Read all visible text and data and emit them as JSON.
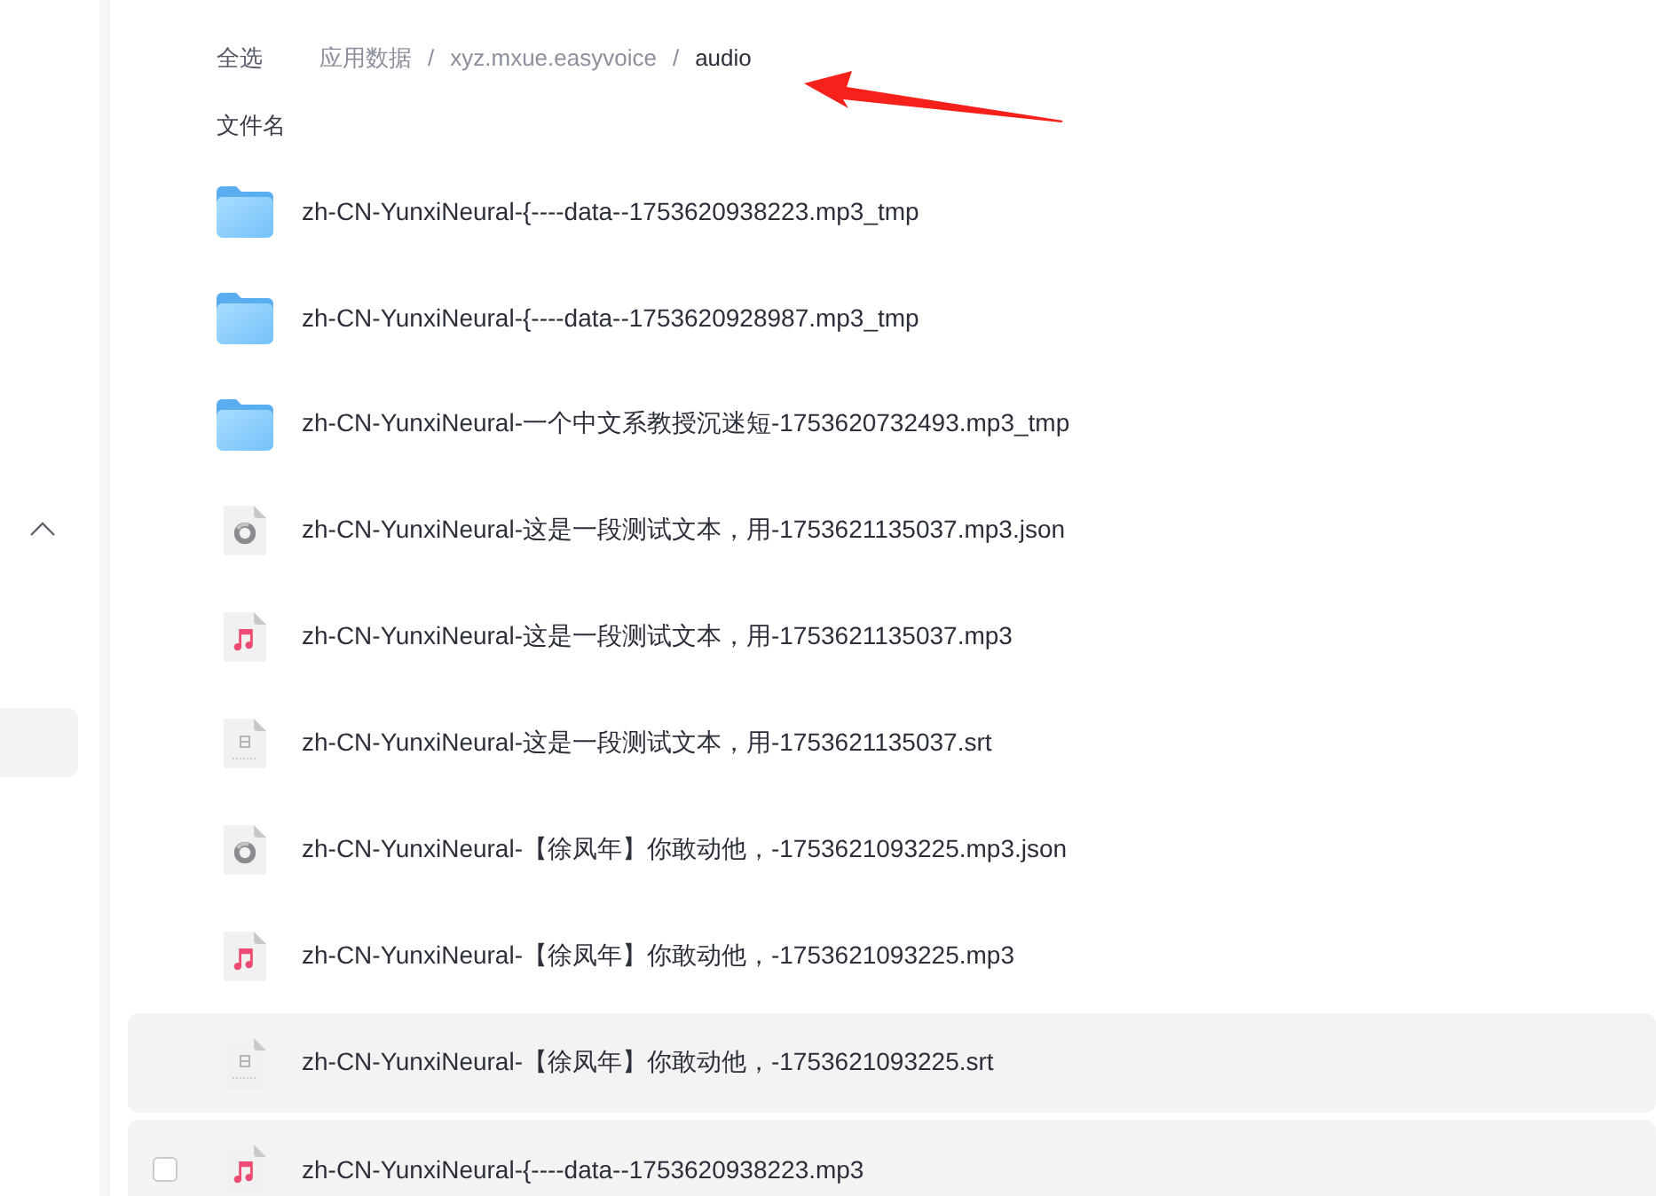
{
  "sidebar": {
    "group_expanded": true,
    "items": [
      {
        "selected": true
      }
    ]
  },
  "toolbar": {
    "select_all": "全选",
    "breadcrumb": [
      {
        "label": "应用数据",
        "current": false
      },
      {
        "separator": "/",
        "label": "xyz.mxue.easyvoice",
        "current": false
      },
      {
        "separator": "/",
        "label": "audio",
        "current": true
      }
    ]
  },
  "table": {
    "column_header": "文件名",
    "rows": [
      {
        "kind": "folder",
        "name": "zh-CN-YunxiNeural-{----data--1753620938223.mp3_tmp",
        "highlighted": false
      },
      {
        "kind": "folder",
        "name": "zh-CN-YunxiNeural-{----data--1753620928987.mp3_tmp",
        "highlighted": false
      },
      {
        "kind": "folder",
        "name": "zh-CN-YunxiNeural-一个中文系教授沉迷短-1753620732493.mp3_tmp",
        "highlighted": false
      },
      {
        "kind": "json",
        "name": "zh-CN-YunxiNeural-这是一段测试文本，用-1753621135037.mp3.json",
        "highlighted": false
      },
      {
        "kind": "audio",
        "name": "zh-CN-YunxiNeural-这是一段测试文本，用-1753621135037.mp3",
        "highlighted": false
      },
      {
        "kind": "subtitle",
        "name": "zh-CN-YunxiNeural-这是一段测试文本，用-1753621135037.srt",
        "highlighted": false
      },
      {
        "kind": "json",
        "name": "zh-CN-YunxiNeural-【徐凤年】你敢动他，-1753621093225.mp3.json",
        "highlighted": false
      },
      {
        "kind": "audio",
        "name": "zh-CN-YunxiNeural-【徐凤年】你敢动他，-1753621093225.mp3",
        "highlighted": false
      },
      {
        "kind": "subtitle",
        "name": "zh-CN-YunxiNeural-【徐凤年】你敢动他，-1753621093225.srt",
        "highlighted": true
      },
      {
        "kind": "audio",
        "name": "zh-CN-YunxiNeural-{----data--1753620938223.mp3",
        "highlighted": true,
        "checkbox": {
          "checked": false
        }
      }
    ]
  },
  "annotations": [
    {
      "kind": "arrow"
    }
  ]
}
